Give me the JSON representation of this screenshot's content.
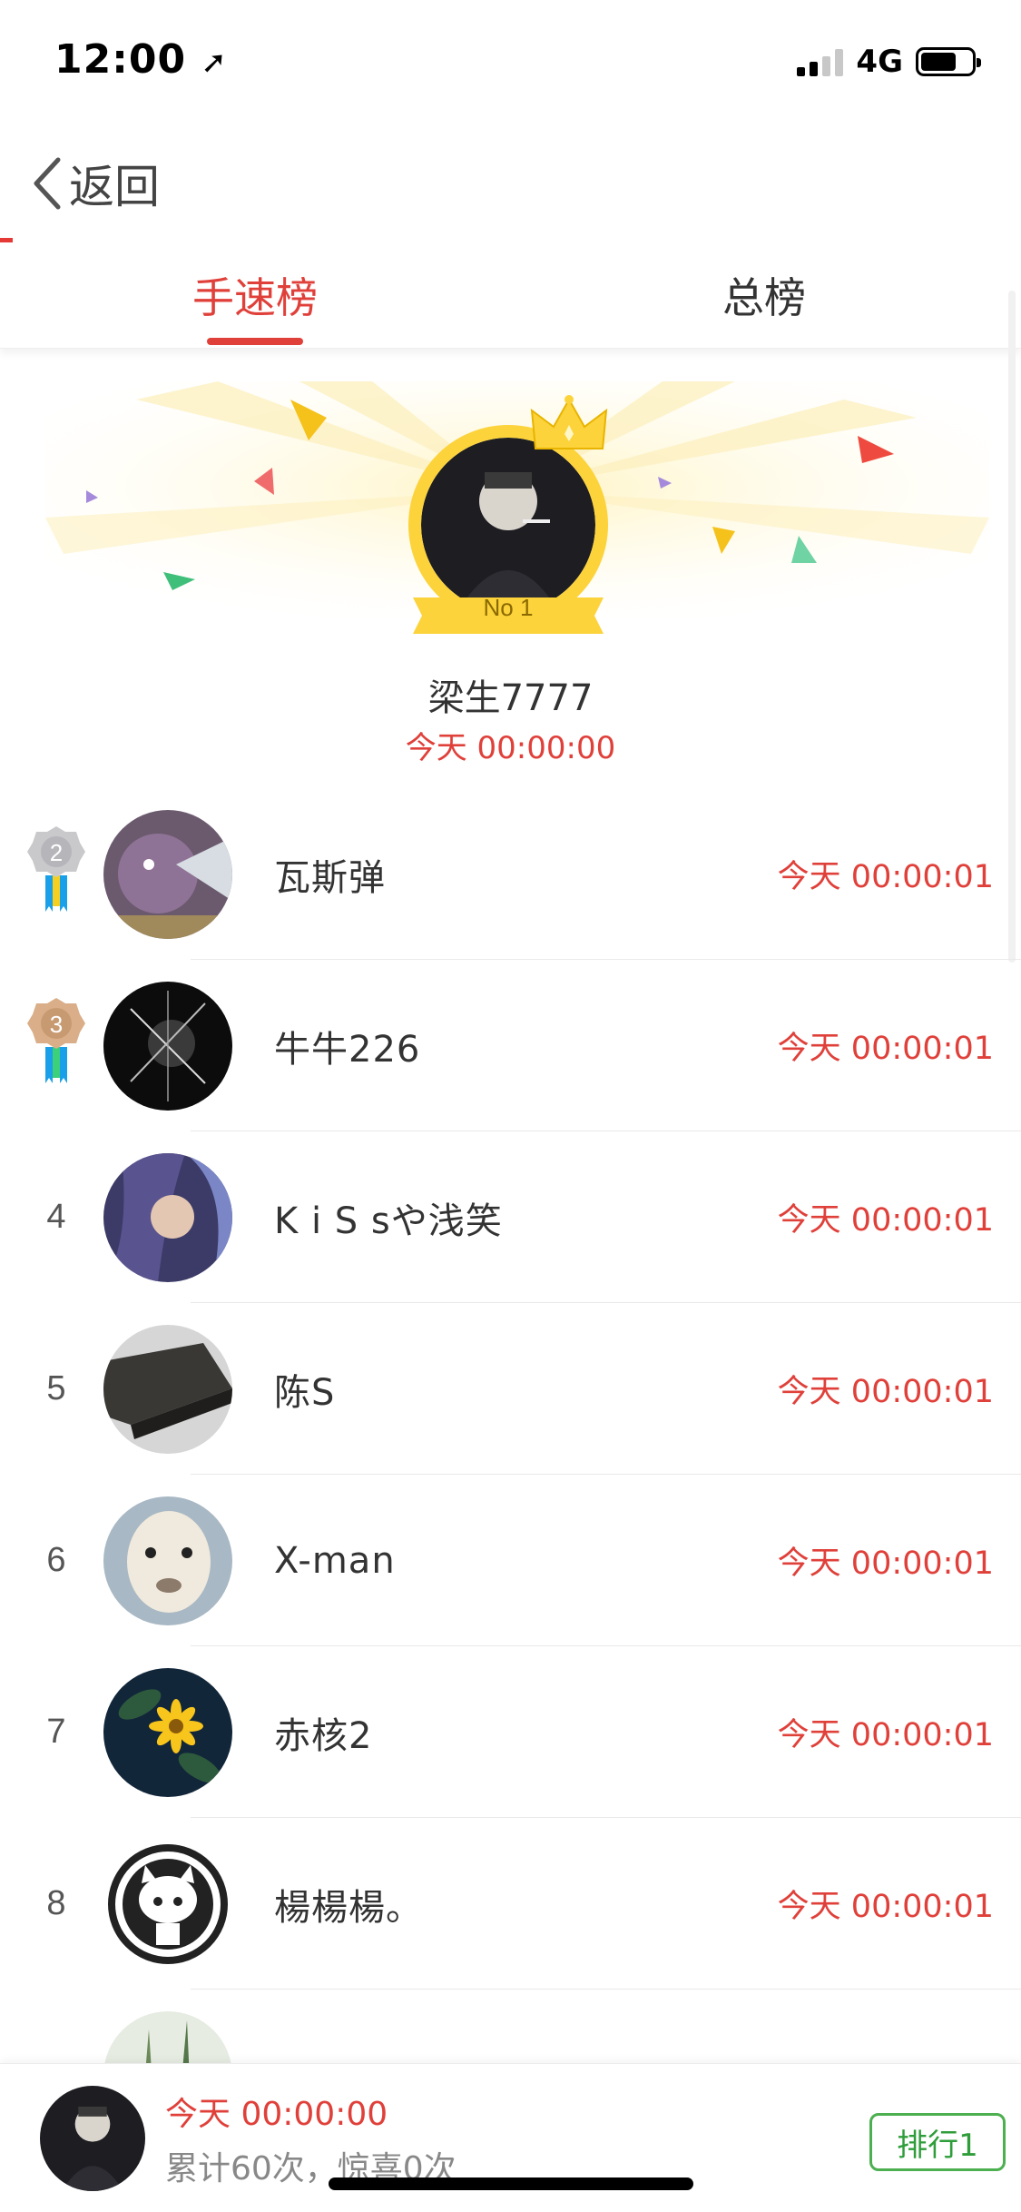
{
  "status_bar": {
    "time": "12:00",
    "network": "4G"
  },
  "nav": {
    "back_label": "返回"
  },
  "tabs": [
    {
      "label": "手速榜",
      "active": true
    },
    {
      "label": "总榜",
      "active": false
    }
  ],
  "champion": {
    "badge": "No 1",
    "name": "梁生7777",
    "time": "今天 00:00:00"
  },
  "ranking": [
    {
      "rank": "2",
      "name": "瓦斯弹",
      "time": "今天 00:00:01"
    },
    {
      "rank": "3",
      "name": "牛牛226",
      "time": "今天 00:00:01"
    },
    {
      "rank": "4",
      "name": "K i S sや浅笑",
      "time": "今天 00:00:01"
    },
    {
      "rank": "5",
      "name": "陈S",
      "time": "今天 00:00:01"
    },
    {
      "rank": "6",
      "name": "X-man",
      "time": "今天 00:00:01"
    },
    {
      "rank": "7",
      "name": "赤核2",
      "time": "今天 00:00:01"
    },
    {
      "rank": "8",
      "name": "楊楊楊。",
      "time": "今天 00:00:01"
    }
  ],
  "me": {
    "time": "今天 00:00:00",
    "stats": "累计60次，惊喜0次",
    "rank_button": "排行1"
  },
  "colors": {
    "accent": "#e0403a",
    "gold": "#fcd33b",
    "green": "#4caf50"
  }
}
